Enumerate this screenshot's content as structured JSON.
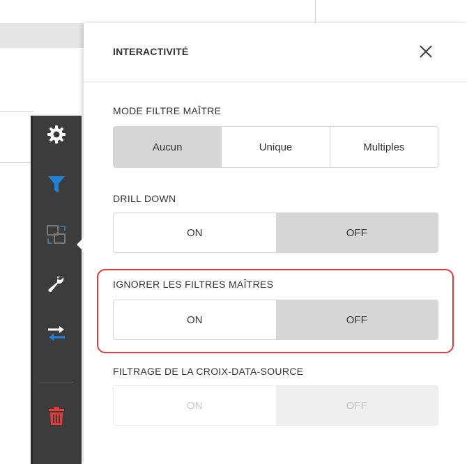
{
  "panel": {
    "title": "INTERACTIVITÉ",
    "close_icon": "close-icon"
  },
  "sections": {
    "master_filter": {
      "label": "MODE FILTRE MAÎTRE",
      "options": [
        "Aucun",
        "Unique",
        "Multiples"
      ],
      "selected": "Aucun"
    },
    "drill_down": {
      "label": "DRILL DOWN",
      "on_label": "ON",
      "off_label": "OFF",
      "selected": "OFF"
    },
    "ignore_master_filters": {
      "label": "IGNORER LES FILTRES MAÎTRES",
      "on_label": "ON",
      "off_label": "OFF",
      "selected": "OFF",
      "highlighted": true
    },
    "cross_datasource": {
      "label": "FILTRAGE DE LA CROIX-DATA-SOURCE",
      "on_label": "ON",
      "off_label": "OFF",
      "selected": "OFF",
      "disabled": true
    }
  },
  "toolbar": {
    "items": [
      {
        "icon": "gear-icon"
      },
      {
        "icon": "filter-icon"
      },
      {
        "icon": "convert-icon"
      },
      {
        "icon": "wrench-icon"
      },
      {
        "icon": "swap-arrows-icon"
      },
      {
        "icon": "trash-icon"
      }
    ]
  },
  "colors": {
    "toolbar_bg": "#3c3c3c",
    "filter_accent": "#1e82d8",
    "delete_accent": "#e23a3a",
    "highlight_border": "#e23a3a",
    "selected_segment": "#d6d6d6"
  }
}
